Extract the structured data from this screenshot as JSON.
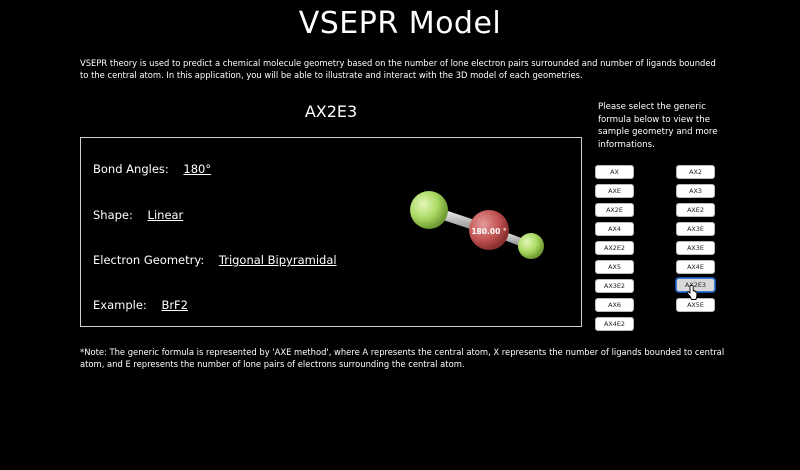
{
  "page": {
    "title": "VSEPR Model",
    "intro": "VSEPR theory is used to predict a chemical molecule geometry based on the number of lone electron pairs surrounded and number of ligands bounded to the central atom. In this application, you will be able to illustrate and interact with the 3D model of each geometries."
  },
  "selected_formula": "AX2E3",
  "details": {
    "bond_angles_label": "Bond Angles:",
    "bond_angles": "180°",
    "shape_label": "Shape:",
    "shape": "Linear",
    "electron_geometry_label": "Electron Geometry:",
    "electron_geometry": "Trigonal Bipyramidal",
    "example_label": "Example:",
    "example": "BrF2"
  },
  "model": {
    "angle_label": "180.00 °",
    "colors": {
      "ligand": "#a8d860",
      "central": "#c45555",
      "bond": "#c8c8c8"
    }
  },
  "sidebar": {
    "instructions": "Please select the generic formula below to view the sample geometry and more informations.",
    "left_buttons": [
      "AX",
      "AXE",
      "AX2E",
      "AX4",
      "AX2E2",
      "AX5",
      "AX3E2",
      "AX6",
      "AX4E2"
    ],
    "right_buttons": [
      "AX2",
      "AX3",
      "AXE2",
      "AX3E",
      "AX3E",
      "AX4E",
      "AX2E3",
      "AX5E"
    ],
    "active_button": "AX2E3"
  },
  "note": "*Note: The generic formula is represented by 'AXE method', where A represents the central atom, X represents the number of ligands bounded to central atom, and E represents the number of lone pairs of electrons surrounding the central atom."
}
